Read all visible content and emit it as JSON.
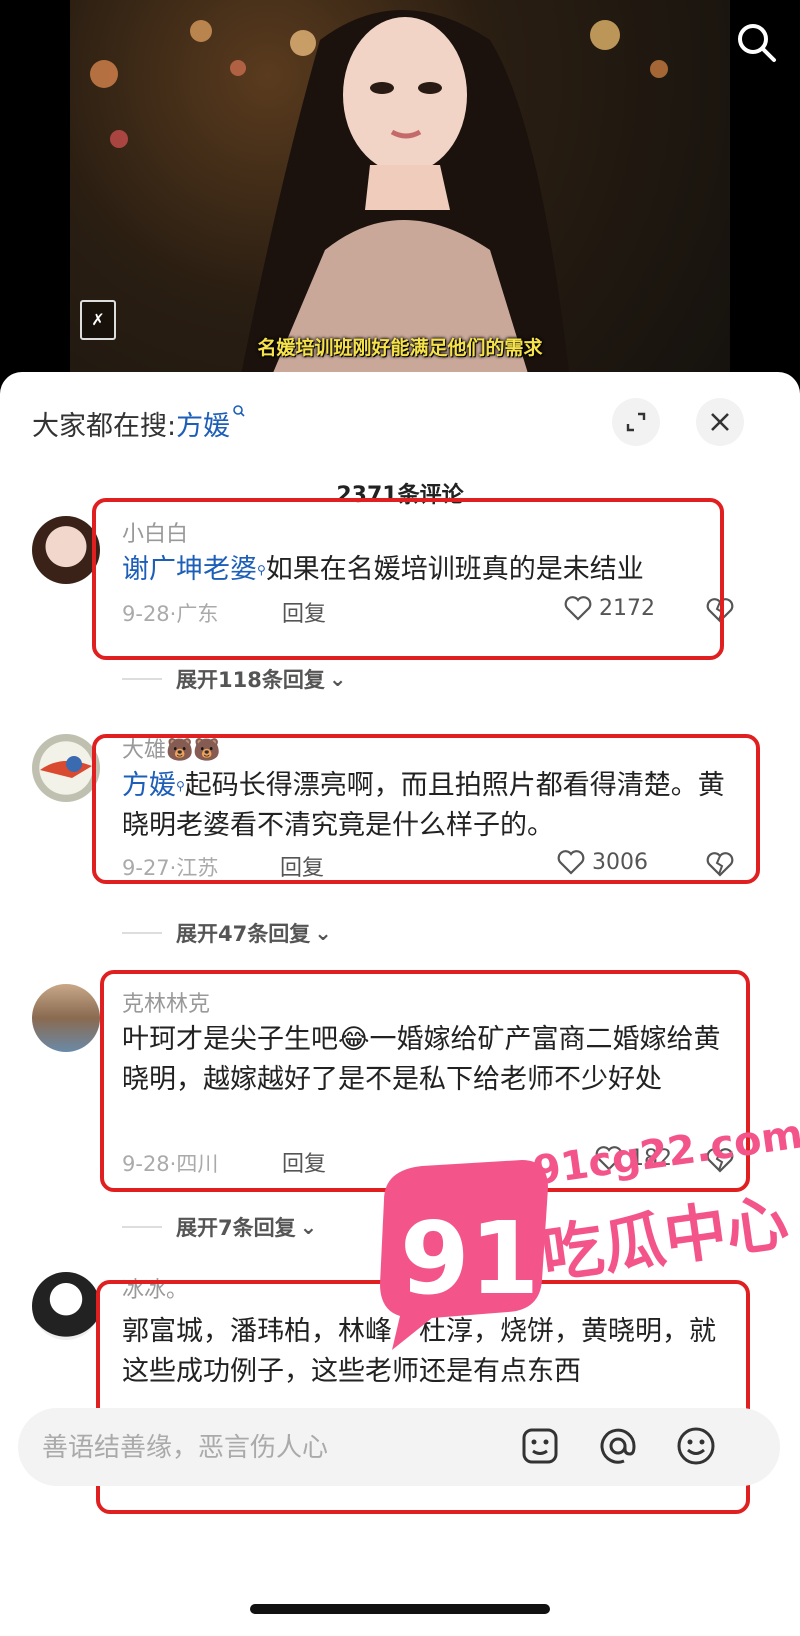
{
  "video": {
    "subtitle": "名媛培训班刚好能满足他们的需求",
    "corner_logo": "✗"
  },
  "search": {
    "prefix": "大家都在搜:",
    "keyword": "方媛"
  },
  "comments_count": "2371条评论",
  "comments": [
    {
      "user": "小白白",
      "mention": "谢广坤老婆",
      "text": "如果在名媛培训班真的是未结业",
      "date": "9-28·广东",
      "reply": "回复",
      "likes": "2172",
      "expand": "展开118条回复"
    },
    {
      "user": "大雄🐻🐻",
      "mention": "方媛",
      "text": "起码长得漂亮啊，而且拍照片都看得清楚。黄晓明老婆看不清究竟是什么样子的。",
      "date": "9-27·江苏",
      "reply": "回复",
      "likes": "3006",
      "expand": "展开47条回复"
    },
    {
      "user": "克林林克",
      "mention": "",
      "text": "叶珂才是尖子生吧😂一婚嫁给矿产富商二婚嫁给黄晓明，越嫁越好了是不是私下给老师不少好处",
      "date": "9-28·四川",
      "reply": "回复",
      "likes": "182",
      "expand": "展开7条回复"
    },
    {
      "user": "冰冰。",
      "mention": "",
      "text": "郭富城，潘玮柏，林峰，杜淳，烧饼，黄晓明，就这些成功例子，这些老师还是有点东西",
      "date": "",
      "reply": "",
      "likes": "",
      "expand": ""
    }
  ],
  "input": {
    "placeholder": "善语结善缘，恶言伤人心"
  },
  "watermark": {
    "number": "91",
    "domain": "91cg22.com",
    "brand": "吃瓜中心"
  }
}
